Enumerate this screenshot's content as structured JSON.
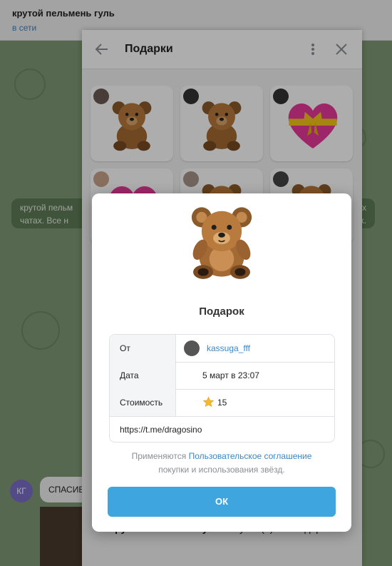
{
  "chat": {
    "title": "крутой пельмень гуль",
    "status": "в сети",
    "system_message": {
      "line1_left": "крутой пельм",
      "line2_left": "чатах. Все н",
      "line1_right": "х",
      "line2_right": "ах."
    },
    "sender_initials": "КГ",
    "message_text": "СПАСИБ"
  },
  "gifts_panel": {
    "title": "Подарки",
    "footer_name": "крутой пельмень гуль",
    "footer_text": " получил(а) эти подарки."
  },
  "modal": {
    "title": "Подарок",
    "rows": {
      "from_label": "От",
      "from_value": "kassuga_fff",
      "date_label": "Дата",
      "date_value": "5 март в 23:07",
      "cost_label": "Стоимость",
      "cost_value": "15"
    },
    "url": "https://t.me/dragosino",
    "terms_prefix": "Применяются ",
    "terms_link": "Пользовательское соглашение",
    "terms_suffix": "покупки и использования звёзд.",
    "ok_label": "ОК"
  },
  "icons": {
    "back": "back-arrow-icon",
    "menu": "more-vertical-icon",
    "close": "close-icon",
    "star": "star-icon",
    "gift_bear": "teddy-bear-icon",
    "gift_heart": "heart-gift-icon"
  },
  "colors": {
    "accent": "#3ea5de",
    "link": "#3a86c8"
  }
}
